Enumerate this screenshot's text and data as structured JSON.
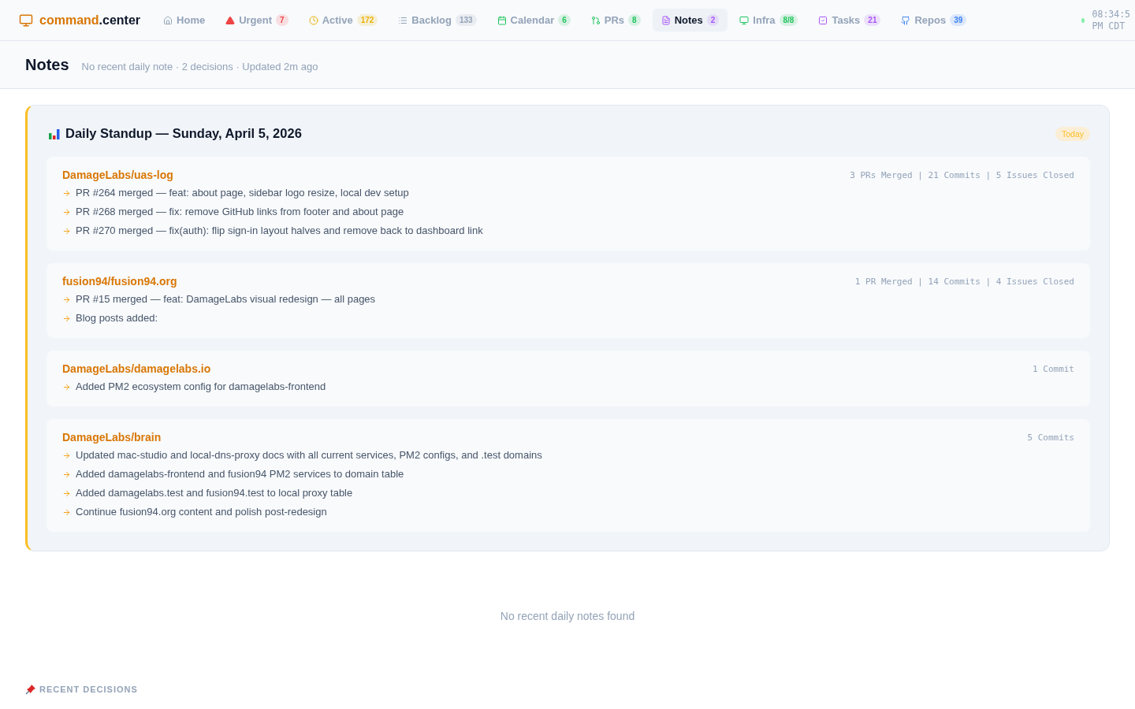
{
  "brand": {
    "accent": "command",
    "rest": ".center"
  },
  "nav": [
    {
      "kind": "home",
      "label": "Home",
      "selected": false
    },
    {
      "kind": "urgent",
      "label": "Urgent",
      "count": "7",
      "color": "#ef4444",
      "selected": false
    },
    {
      "kind": "active",
      "label": "Active",
      "count": "172",
      "color": "#eab308",
      "selected": false
    },
    {
      "kind": "backlog",
      "label": "Backlog",
      "count": "133",
      "color": "#94a3b8",
      "selected": false
    },
    {
      "kind": "calendar",
      "label": "Calendar",
      "count": "6",
      "color": "#22c55e",
      "selected": false
    },
    {
      "kind": "prs",
      "label": "PRs",
      "count": "8",
      "color": "#22c55e",
      "selected": false
    },
    {
      "kind": "notes",
      "label": "Notes",
      "count": "2",
      "color": "#a855f7",
      "selected": true
    },
    {
      "kind": "infra",
      "label": "Infra",
      "count": "8/8",
      "color": "#22c55e",
      "selected": false
    },
    {
      "kind": "tasks",
      "label": "Tasks",
      "count": "21",
      "color": "#a855f7",
      "selected": false
    },
    {
      "kind": "repos",
      "label": "Repos",
      "count": "39",
      "color": "#3b82f6",
      "selected": false
    }
  ],
  "clock": {
    "time": "08:34:5",
    "zone": "PM CDT"
  },
  "page": {
    "title": "Notes",
    "subtitle": "No recent daily note · 2 decisions · Updated 2m ago"
  },
  "standup": {
    "title": "Daily Standup — Sunday, April 5, 2026",
    "badge": "Today",
    "repos": [
      {
        "name": "DamageLabs/uas-log",
        "stats": "3 PRs Merged | 21 Commits | 5 Issues Closed",
        "items": [
          "PR #264 merged — feat: about page, sidebar logo resize, local dev setup",
          "PR #268 merged — fix: remove GitHub links from footer and about page",
          "PR #270 merged — fix(auth): flip sign-in layout halves and remove back to dashboard link"
        ]
      },
      {
        "name": "fusion94/fusion94.org",
        "stats": "1 PR Merged | 14 Commits | 4 Issues Closed",
        "items": [
          "PR #15 merged — feat: DamageLabs visual redesign — all pages",
          "Blog posts added:"
        ]
      },
      {
        "name": "DamageLabs/damagelabs.io",
        "stats": "1 Commit",
        "items": [
          "Added PM2 ecosystem config for damagelabs-frontend"
        ]
      },
      {
        "name": "DamageLabs/brain",
        "stats": "5 Commits",
        "items": [
          "Updated mac-studio and local-dns-proxy docs with all current services, PM2 configs, and .test domains",
          "Added damagelabs-frontend and fusion94 PM2 services to domain table",
          "Added damagelabs.test and fusion94.test to local proxy table",
          "Continue fusion94.org content and polish post-redesign"
        ]
      }
    ]
  },
  "empty": "No recent daily notes found",
  "decisions": {
    "heading": "RECENT DECISIONS"
  }
}
